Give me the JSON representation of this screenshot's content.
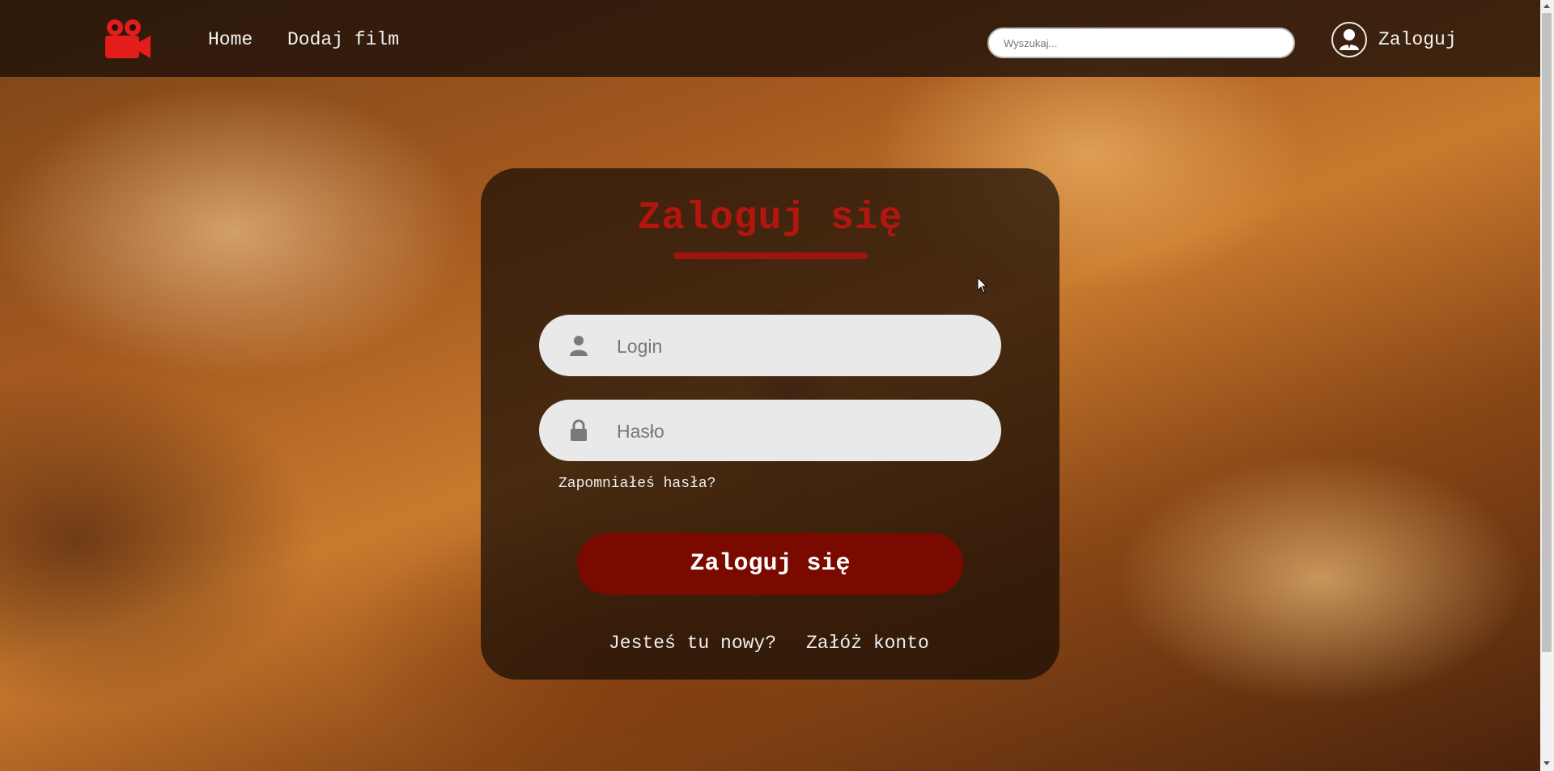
{
  "navbar": {
    "logo_icon": "video-camera-icon",
    "links": [
      "Home",
      "Dodaj film"
    ],
    "search_placeholder": "Wyszukaj...",
    "user_icon": "user-icon",
    "login_label": "Zaloguj"
  },
  "login_form": {
    "title": "Zaloguj się",
    "login_placeholder": "Login",
    "password_placeholder": "Hasło",
    "forgot_password": "Zapomniałeś hasła?",
    "submit_label": "Zaloguj się",
    "new_user_prompt": "Jesteś tu nowy?",
    "register_link": "Załóż konto"
  },
  "colors": {
    "accent": "#b3150f",
    "button": "#7a0a00"
  }
}
